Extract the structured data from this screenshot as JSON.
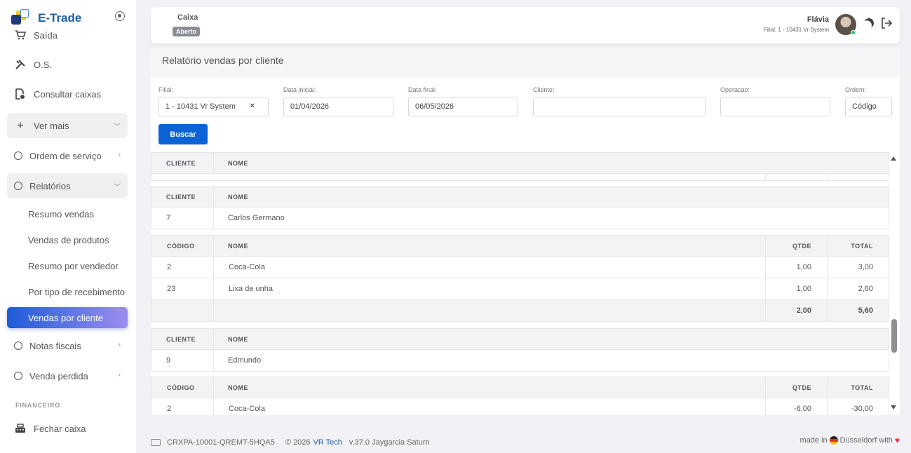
{
  "brand": {
    "name": "E-Trade"
  },
  "sidebar": {
    "items": [
      {
        "label": "Saída"
      },
      {
        "label": "O.S."
      },
      {
        "label": "Consultar caixas"
      },
      {
        "label": "Ver mais"
      },
      {
        "label": "Ordem de serviço"
      },
      {
        "label": "Relatórios"
      },
      {
        "label": "Notas fiscais"
      },
      {
        "label": "Venda perdida"
      },
      {
        "label": "Fechar caixa"
      }
    ],
    "sub_items": [
      {
        "label": "Resumo vendas"
      },
      {
        "label": "Vendas de produtos"
      },
      {
        "label": "Resumo por vendedor"
      },
      {
        "label": "Por tipo de recebimento"
      },
      {
        "label": "Vendas por cliente"
      }
    ],
    "section_financeiro": "FINANCEIRO"
  },
  "header": {
    "caixa_label": "Caixa",
    "caixa_status": "Aberto",
    "user_name": "Flávia",
    "user_filial": "Filial: 1 - 10431 Vr System"
  },
  "report": {
    "title": "Relatório vendas por cliente",
    "filters": {
      "filial_label": "Filial:",
      "filial_value": "1 - 10431 Vr System",
      "data_inicial_label": "Data inicial:",
      "data_inicial_value": "01/04/2026",
      "data_final_label": "Data final:",
      "data_final_value": "06/05/2026",
      "cliente_label": "Cliente:",
      "cliente_value": "",
      "operacao_label": "Operacao:",
      "operacao_value": "",
      "ordem_label": "Ordem:",
      "ordem_value": "Código"
    },
    "buscar_label": "Buscar",
    "headers": {
      "cliente": "CLIENTE",
      "nome": "NOME",
      "codigo": "CÓDIGO",
      "qtde": "QTDE",
      "total": "TOTAL"
    },
    "clients": [
      {
        "cliente": "7",
        "nome": "Carlos Germano",
        "products": [
          {
            "codigo": "2",
            "nome": "Coca-Cola",
            "qtde": "1,00",
            "total": "3,00"
          },
          {
            "codigo": "23",
            "nome": "Lixa de unha",
            "qtde": "1,00",
            "total": "2,60"
          }
        ],
        "sum_qtde": "2,00",
        "sum_total": "5,60"
      },
      {
        "cliente": "9",
        "nome": "Edmundo",
        "products": [
          {
            "codigo": "2",
            "nome": "Coca-Cola",
            "qtde": "-6,00",
            "total": "-30,00"
          }
        ]
      }
    ]
  },
  "footer": {
    "license": "CRXPA-10001-QREMT-5HQA5",
    "copyright": "© 2026",
    "company": "VR Tech",
    "version": "v.37.0 Jaygarcia Saturn",
    "made_in": "made in",
    "city": "Düsseldorf with"
  }
}
